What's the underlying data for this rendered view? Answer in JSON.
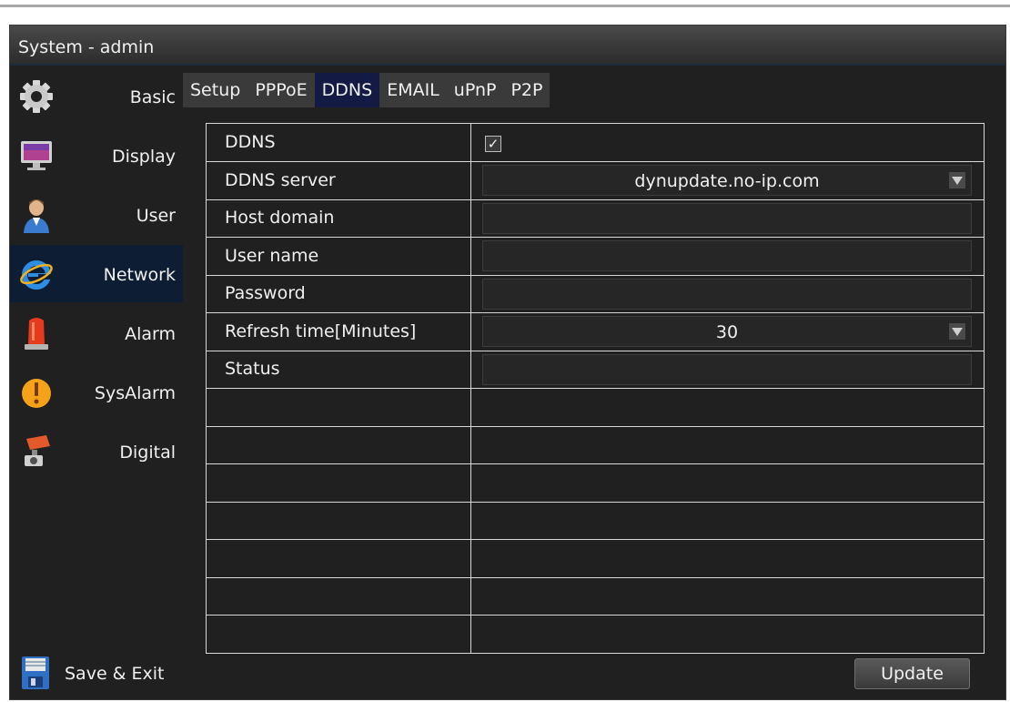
{
  "window": {
    "title": "System - admin"
  },
  "sidebar": {
    "items": [
      {
        "label": "Basic",
        "icon": "gear-icon"
      },
      {
        "label": "Display",
        "icon": "monitor-icon"
      },
      {
        "label": "User",
        "icon": "user-icon"
      },
      {
        "label": "Network",
        "icon": "internet-explorer-icon",
        "active": true
      },
      {
        "label": "Alarm",
        "icon": "siren-icon"
      },
      {
        "label": "SysAlarm",
        "icon": "warning-icon"
      },
      {
        "label": "Digital",
        "icon": "camera-icon"
      }
    ],
    "save_exit": {
      "label": "Save & Exit",
      "icon": "floppy-disk-icon"
    }
  },
  "tabs": [
    {
      "label": "Setup"
    },
    {
      "label": "PPPoE"
    },
    {
      "label": "DDNS",
      "active": true
    },
    {
      "label": "EMAIL"
    },
    {
      "label": "uPnP"
    },
    {
      "label": "P2P"
    }
  ],
  "form": {
    "ddns": {
      "label": "DDNS",
      "checked": true,
      "check_glyph": "✓"
    },
    "ddns_server": {
      "label": "DDNS server",
      "value": "dynupdate.no-ip.com"
    },
    "host_domain": {
      "label": "Host domain",
      "value": ""
    },
    "user_name": {
      "label": "User name",
      "value": ""
    },
    "password": {
      "label": "Password",
      "value": ""
    },
    "refresh_time": {
      "label": "Refresh time[Minutes]",
      "value": "30"
    },
    "status": {
      "label": "Status",
      "value": ""
    }
  },
  "buttons": {
    "update": "Update"
  },
  "colors": {
    "active_sidebar": "#0d1d33",
    "active_tab": "#131a44",
    "background": "#202020"
  }
}
